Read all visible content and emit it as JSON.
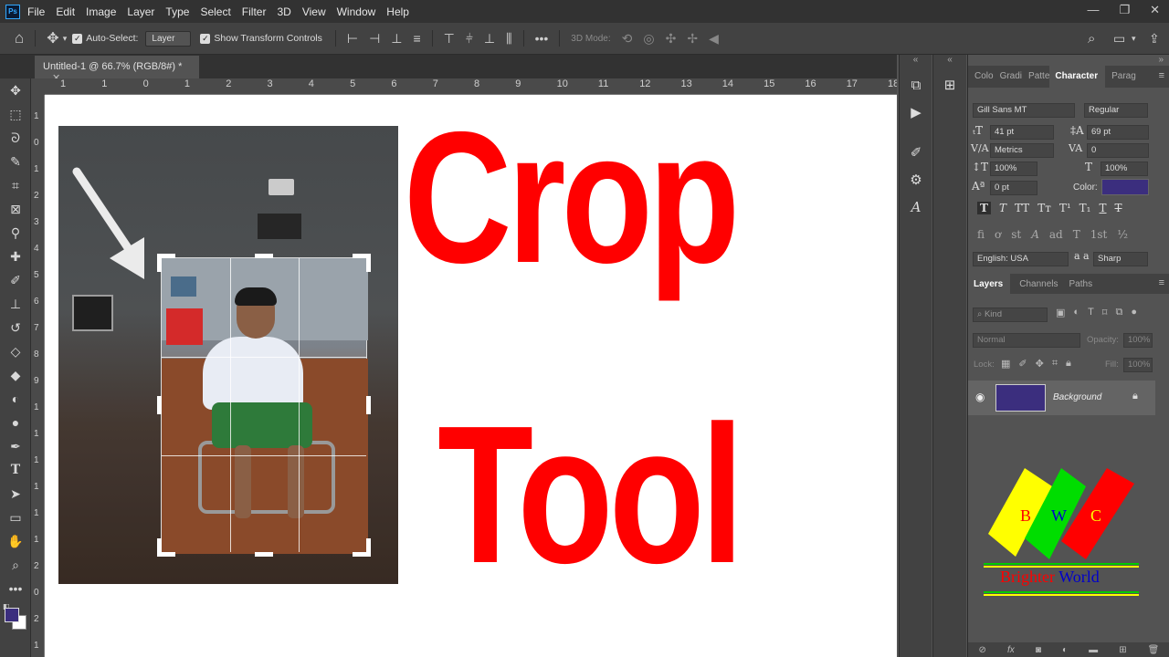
{
  "menubar": {
    "items": [
      "File",
      "Edit",
      "Image",
      "Layer",
      "Type",
      "Select",
      "Filter",
      "3D",
      "View",
      "Window",
      "Help"
    ],
    "logo": "Ps"
  },
  "options": {
    "auto_select_label": "Auto-Select:",
    "layer_select": "Layer",
    "show_transform_label": "Show Transform Controls",
    "three_d_mode": "3D Mode:"
  },
  "document": {
    "tab_title": "Untitled-1 @ 66.7% (RGB/8#) *"
  },
  "ruler": {
    "h_ticks": [
      "1",
      "1",
      "0",
      "1",
      "2",
      "3",
      "4",
      "5",
      "6",
      "7",
      "8",
      "9",
      "10",
      "11",
      "12",
      "13",
      "14",
      "15",
      "16",
      "17",
      "18"
    ],
    "v_ticks": [
      "1",
      "0",
      "1",
      "2",
      "3",
      "4",
      "5",
      "6",
      "7",
      "8",
      "9",
      "1",
      "1",
      "1",
      "1",
      "1",
      "1",
      "2",
      "0",
      "2",
      "1"
    ]
  },
  "canvas": {
    "title_line1": "Crop",
    "title_line2": "Tool"
  },
  "character_panel": {
    "tabs": [
      "Colo",
      "Gradi",
      "Patte",
      "Character",
      "Parag"
    ],
    "font_family": "Gill Sans MT",
    "font_style": "Regular",
    "font_size": "41 pt",
    "leading": "69 pt",
    "kerning": "Metrics",
    "tracking": "0",
    "vertical_scale": "100%",
    "horizontal_scale": "100%",
    "baseline_shift": "0 pt",
    "color_label": "Color:",
    "color": "#3b2e7e",
    "style_buttons": [
      "T",
      "T",
      "TT",
      "Tт",
      "T¹",
      "T₁",
      "T",
      "T"
    ],
    "opentype_buttons": [
      "fi",
      "ơ",
      "st",
      "A",
      "ad",
      "T",
      "1st",
      "½"
    ],
    "language": "English: USA",
    "aa_label": "a a",
    "antialias": "Sharp"
  },
  "layers_panel": {
    "tabs": [
      "Layers",
      "Channels",
      "Paths"
    ],
    "kind_label": "Kind",
    "blend_mode": "Normal",
    "opacity_label": "Opacity:",
    "opacity_value": "100%",
    "lock_label": "Lock:",
    "fill_label": "Fill:",
    "fill_value": "100%",
    "layer_name": "Background"
  },
  "logo": {
    "letters": [
      "B",
      "W",
      "C"
    ],
    "word1": "Brighter",
    "word2": "World",
    "colors": {
      "yellow": "#ffff00",
      "green": "#00dd00",
      "red": "#ff0000",
      "blue": "#0000cc"
    }
  }
}
